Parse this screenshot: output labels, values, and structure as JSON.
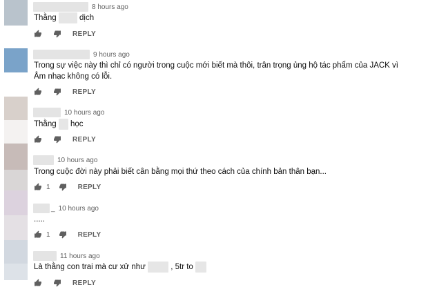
{
  "theme": {
    "text": "#0f0f0f",
    "meta": "#606060",
    "blur": "#e4e4e4"
  },
  "icons": {
    "like": "thumbs-up-icon",
    "dislike": "thumbs-down-icon"
  },
  "comments": [
    {
      "time": "8 hours ago",
      "text_a": "Thằng",
      "text_b": "dịch",
      "reply": "REPLY",
      "avatar_color": "#b9c3cc"
    },
    {
      "time": "9 hours ago",
      "text": "Trong sự việc này thì chỉ có người trong cuộc mới biết mà thôi, trân trọng ủng hộ tác phẩm của JACK vì Âm nhạc không có lỗi.",
      "reply": "REPLY",
      "avatar_color": "#7aa3c9"
    },
    {
      "time": "10 hours ago",
      "text_a": "Thằng",
      "text_b": "học",
      "reply": "REPLY",
      "avatar_color": "#d8d0cb"
    },
    {
      "time": "10 hours ago",
      "text": "Trong cuộc đời này phải biết cân bằng mọi thứ theo cách của chính bản thân bạn...",
      "likes": "1",
      "reply": "REPLY",
      "avatar_color": "#c7bbb8"
    },
    {
      "time": "10 hours ago",
      "name_suffix": "_",
      "text": ".....",
      "likes": "1",
      "reply": "REPLY",
      "avatar_color": "#dcd2de"
    },
    {
      "time": "11 hours ago",
      "text_a": "Là thằng con trai mà cư xử như",
      "text_b": ", 5tr to",
      "reply": "REPLY",
      "avatar_color": "#d2d8e0"
    }
  ]
}
